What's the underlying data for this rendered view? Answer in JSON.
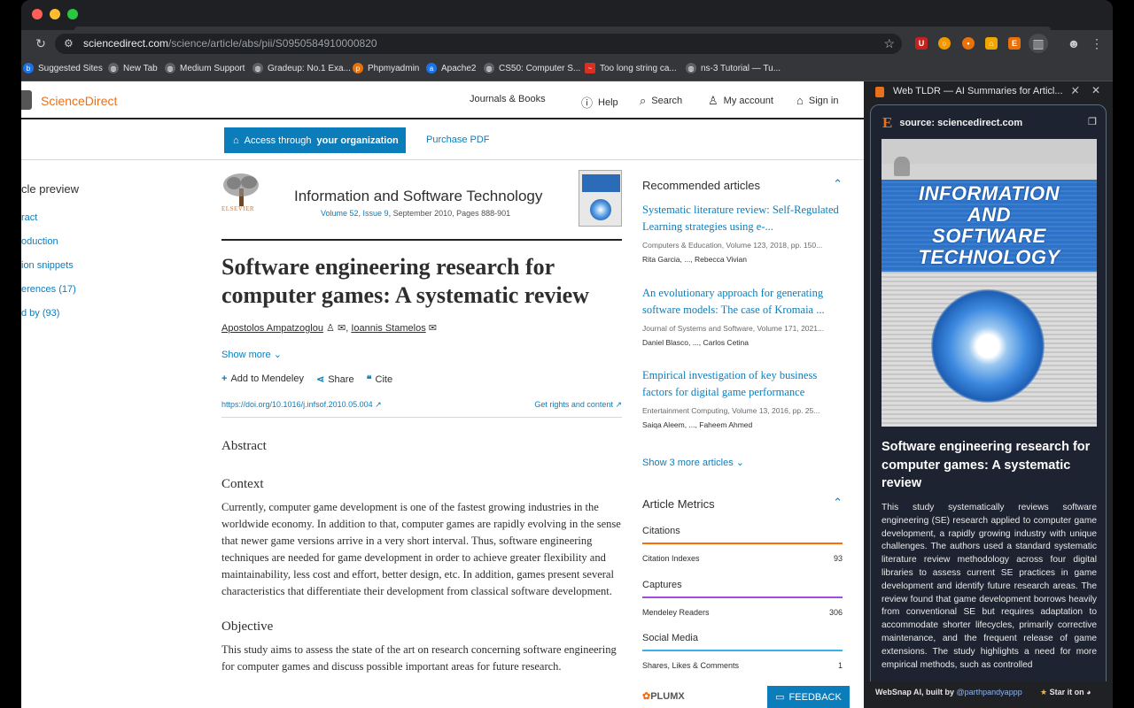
{
  "browser": {
    "url_host": "sciencedirect.com",
    "url_path": "/science/article/abs/pii/S0950584910000820",
    "bookmarks": [
      {
        "label": "Suggested Sites",
        "icon": "bing-icon",
        "color": "#1a73e8"
      },
      {
        "label": "New Tab",
        "icon": "globe-icon",
        "color": "#5f6368"
      },
      {
        "label": "Medium Support",
        "icon": "globe-icon",
        "color": "#5f6368"
      },
      {
        "label": "Gradeup: No.1 Exa...",
        "icon": "globe-icon",
        "color": "#5f6368"
      },
      {
        "label": "Phpmyadmin",
        "icon": "pma-icon",
        "color": "#e8710a"
      },
      {
        "label": "Apache2",
        "icon": "apache-icon",
        "color": "#1a73e8"
      },
      {
        "label": "CS50: Computer S...",
        "icon": "globe-icon",
        "color": "#5f6368"
      },
      {
        "label": "Too long string ca...",
        "icon": "feather-icon",
        "color": "#d93025"
      },
      {
        "label": "ns-3 Tutorial — Tu...",
        "icon": "globe-icon",
        "color": "#5f6368"
      }
    ]
  },
  "header": {
    "logo": "ScienceDirect",
    "journals": "Journals & Books",
    "help": "Help",
    "search": "Search",
    "account": "My account",
    "signin": "Sign in"
  },
  "access": {
    "button_pre": "Access through",
    "button_bold": "your organization",
    "purchase": "Purchase PDF"
  },
  "left_nav": {
    "title": "cle preview",
    "items": [
      "ract",
      "oduction",
      "ion snippets",
      "erences (17)",
      "d by (93)"
    ]
  },
  "journal": {
    "publisher": "ELSEVIER",
    "name": "Information and Software Technology",
    "volume_link": "Volume 52, Issue 9",
    "issue_rest": ", September 2010, Pages 888-901"
  },
  "article": {
    "title": "Software engineering research for computer games: A systematic review",
    "author1": "Apostolos Ampatzoglou",
    "author2": "Ioannis Stamelos",
    "show_more": "Show more",
    "add_mendeley": "Add to Mendeley",
    "share": "Share",
    "cite": "Cite",
    "doi": "https://doi.org/10.1016/j.infsof.2010.05.004",
    "rights": "Get rights and content",
    "abstract_heading": "Abstract",
    "context_heading": "Context",
    "context_text": "Currently, computer game development is one of the fastest growing industries in the worldwide economy. In addition to that, computer games are rapidly evolving in the sense that newer game versions arrive in a very short interval. Thus, software engineering techniques are needed for game development in order to achieve greater flexibility and maintainability, less cost and effort, better design, etc. In addition, games present several characteristics that differentiate their development from classical software development.",
    "objective_heading": "Objective",
    "objective_text": "This study aims to assess the state of the art on research concerning software engineering for computer games and discuss possible important areas for future research."
  },
  "recommended": {
    "heading": "Recommended articles",
    "items": [
      {
        "title": "Systematic literature review: Self-Regulated Learning strategies using e-...",
        "source": "Computers & Education, Volume 123, 2018, pp. 150...",
        "authors": "Rita Garcia, ..., Rebecca Vivian"
      },
      {
        "title": "An evolutionary approach for generating software models: The case of Kromaia ...",
        "source": "Journal of Systems and Software, Volume 171, 2021...",
        "authors": "Daniel Blasco, ..., Carlos Cetina"
      },
      {
        "title": "Empirical investigation of key business factors for digital game performance",
        "source": "Entertainment Computing, Volume 13, 2016, pp. 25...",
        "authors": "Saiqa Aleem, ..., Faheem Ahmed"
      }
    ],
    "show_more": "Show 3 more articles"
  },
  "metrics": {
    "heading": "Article Metrics",
    "citations": "Citations",
    "citation_indexes": "Citation Indexes",
    "citation_indexes_val": "93",
    "captures": "Captures",
    "mendeley_readers": "Mendeley Readers",
    "mendeley_readers_val": "306",
    "social": "Social Media",
    "shares": "Shares, Likes & Comments",
    "shares_val": "1",
    "plumx": "PLUMX",
    "feedback": "FEEDBACK"
  },
  "panel": {
    "tab_title": "Web TLDR — AI Summaries for Articl...",
    "source": "source: sciencedirect.com",
    "cover_lines": [
      "INFORMATION",
      "AND",
      "SOFTWARE",
      "TECHNOLOGY"
    ],
    "title": "Software engineering research for computer games: A systematic review",
    "summary": "This study systematically reviews software engineering (SE) research applied to computer game development, a rapidly growing industry with unique challenges. The authors used a standard systematic literature review methodology across four digital libraries to assess current SE practices in game development and identify future research areas. The review found that game development borrows heavily from conventional SE but requires adaptation to accommodate shorter lifecycles, primarily corrective maintenance, and the frequent release of game extensions. The study highlights a need for more empirical methods, such as controlled",
    "footer_pre": "WebSnap AI, built by ",
    "footer_handle": "@parthpandyappp",
    "footer_star": "Star it on"
  },
  "colors": {
    "accent": "#0c7dbb",
    "brand": "#e9711c",
    "citations_line": "#ff6c00",
    "captures_line": "#a24de0",
    "social_line": "#3ab1e8"
  }
}
